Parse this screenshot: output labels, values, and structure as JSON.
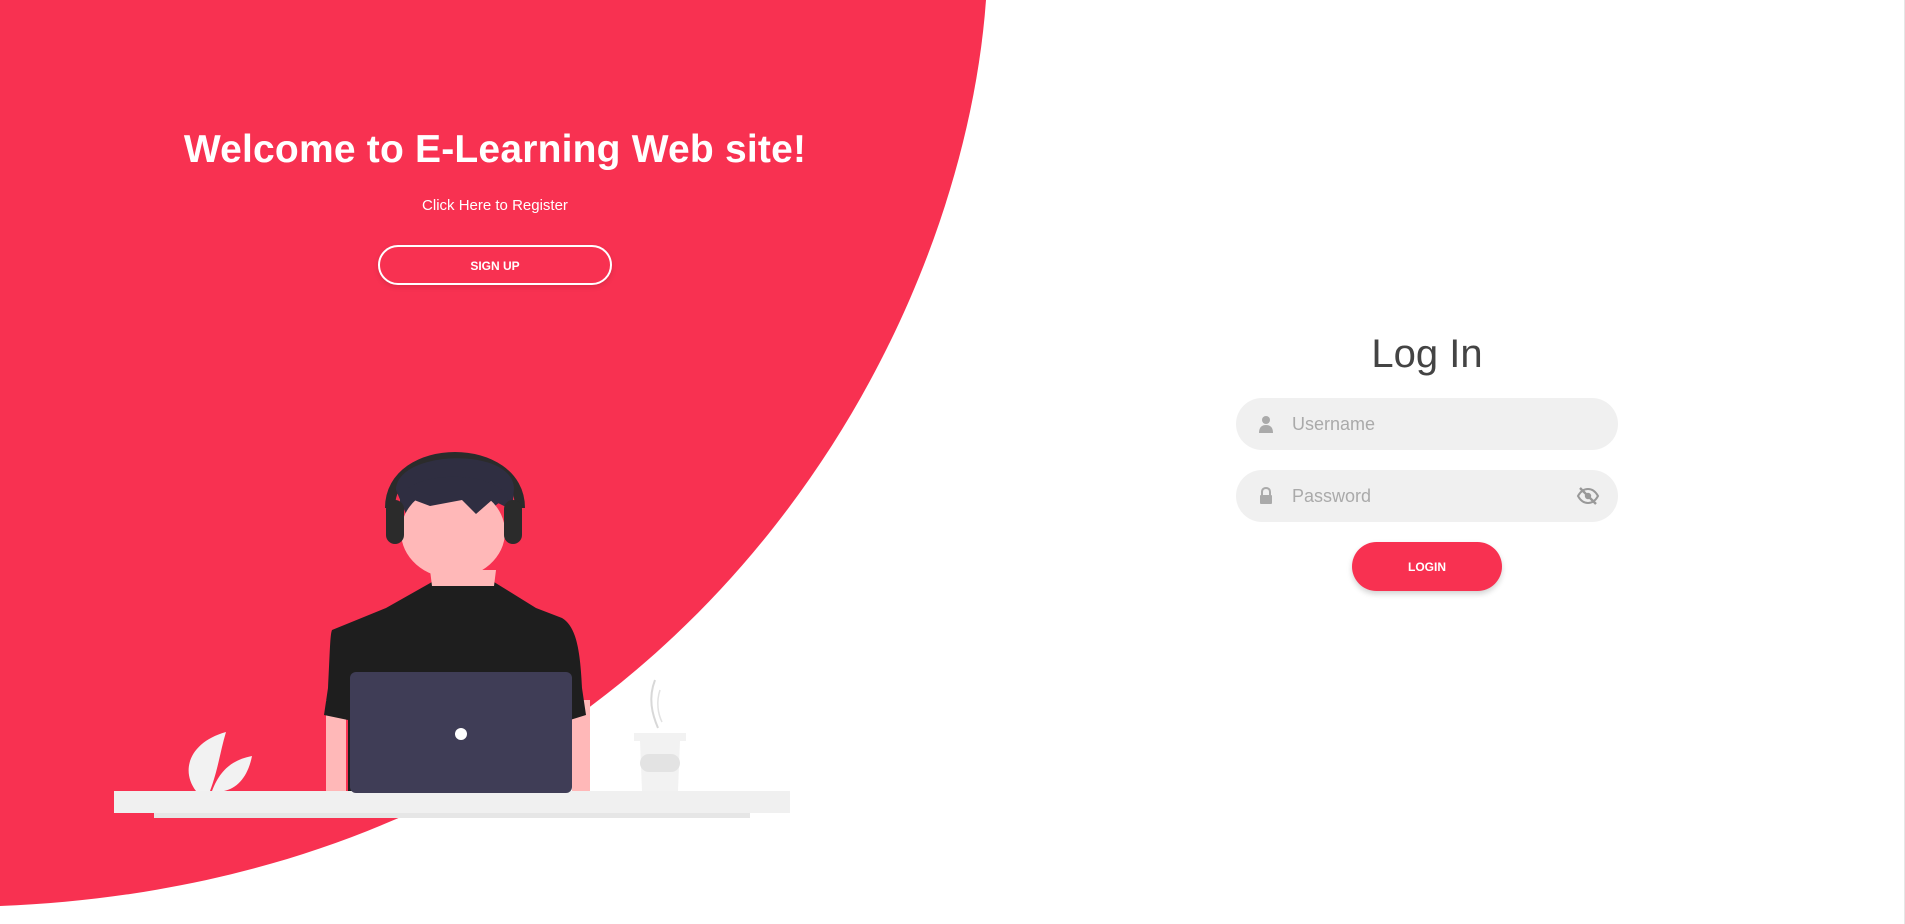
{
  "colors": {
    "accent": "#f83151",
    "white": "#ffffff",
    "input_bg": "#f0f0f0",
    "title_text": "#444444",
    "placeholder": "#aaaaaa"
  },
  "welcome_panel": {
    "title": "Welcome to E-Learning Web site!",
    "register_text": "Click Here to Register",
    "signup_label": "SIGN UP"
  },
  "login": {
    "title": "Log In",
    "username": {
      "placeholder": "Username",
      "value": "",
      "icon": "user-icon"
    },
    "password": {
      "placeholder": "Password",
      "value": "",
      "icon": "lock-icon",
      "toggle_icon": "eye-slash-icon"
    },
    "submit_label": "LOGIN"
  }
}
